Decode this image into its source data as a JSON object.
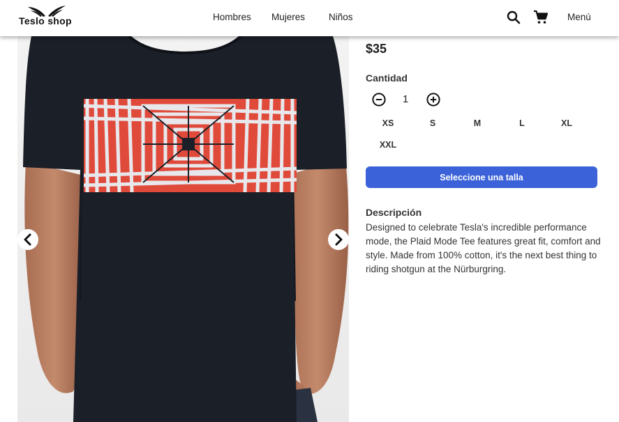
{
  "header": {
    "logo_text": "Teslo shop",
    "nav": [
      "Hombres",
      "Mujeres",
      "Niños"
    ],
    "icons": [
      "search-icon",
      "cart-icon"
    ],
    "menu_label": "Menú"
  },
  "gallery": {
    "prev_icon": "chevron-left-icon",
    "next_icon": "chevron-right-icon"
  },
  "product": {
    "price": "$35",
    "quantity_label": "Cantidad",
    "quantity": "1",
    "sizes": [
      "XS",
      "S",
      "M",
      "L",
      "XL",
      "XXL"
    ],
    "cta_label": "Seleccione una talla",
    "description_title": "Descripción",
    "description": "Designed to celebrate Tesla's incredible performance mode, the Plaid Mode Tee features great fit, comfort and style. Made from 100% cotton, it's the next best thing to riding shotgun at the Nürburgring."
  },
  "colors": {
    "accent": "#3b62d8",
    "shirt": "#1b1f27",
    "print_red": "#e04a3a",
    "print_white": "#e8e8ec"
  }
}
